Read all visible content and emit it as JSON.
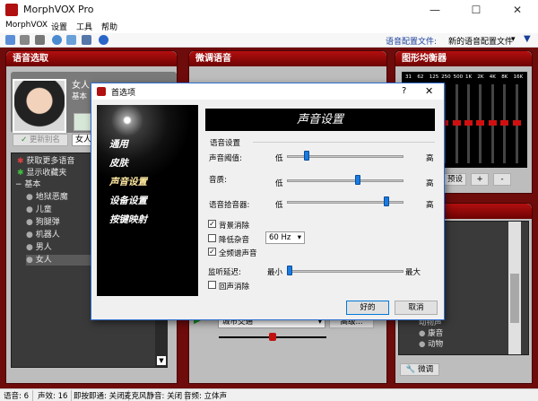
{
  "app": {
    "title": "MorphVOX Pro",
    "brand_color": "#b01010"
  },
  "window_controls": {
    "minimize": "—",
    "maximize": "☐",
    "close": "✕"
  },
  "menu": [
    "MorphVOX",
    "设置",
    "工具",
    "帮助"
  ],
  "toolbar": {
    "voice_config_label": "语音配置文件:",
    "voice_config_value": "新的语音配置文件",
    "filter_icon": "filter-icon"
  },
  "panels": {
    "voice_select": {
      "title": "语音选取"
    },
    "tweak_voice": {
      "title": "微调语音"
    },
    "equalizer": {
      "title": "图形均衡器",
      "bands": [
        "31",
        "62",
        "125",
        "250",
        "500",
        "1K",
        "2K",
        "4K",
        "8K",
        "16K"
      ],
      "preset_label": "预设",
      "plus": "+",
      "minus": "-"
    }
  },
  "voice_card": {
    "name": "女人",
    "category": "基本",
    "rename_label": "更新别名",
    "alias_value": "女人"
  },
  "voice_tree": [
    "获取更多语音",
    "显示收藏夹",
    "基本",
    "地狱恶魔",
    "儿童",
    "狗腿弹",
    "机器人",
    "男人",
    "女人"
  ],
  "background": {
    "play_icon": "play-icon",
    "value": "城市交通",
    "advanced_label": "高级..."
  },
  "sound_list": [
    "动物声",
    "康音",
    "动物"
  ],
  "tweak_button": "微调",
  "dialog": {
    "title": "首选项",
    "help": "?",
    "close": "✕",
    "nav": [
      "通用",
      "皮肤",
      "声音设置",
      "设备设置",
      "按键映射"
    ],
    "nav_selected": "声音设置",
    "header": "声音设置",
    "group_label": "语音设置",
    "sliders": [
      {
        "label": "声音阈值:",
        "low": "低",
        "high": "高",
        "value": 0.15
      },
      {
        "label": "音质:",
        "low": "低",
        "high": "高",
        "value": 0.61
      },
      {
        "label": "语音拾音器:",
        "low": "低",
        "high": "高",
        "value": 0.87
      }
    ],
    "checkboxes": [
      {
        "label": "背景消除",
        "checked": true
      },
      {
        "label": "降低杂音",
        "checked": false
      },
      {
        "label": "全频谱声音",
        "checked": true
      }
    ],
    "hum_select": "60 Hz",
    "latency": {
      "label": "监听延迟:",
      "min": "最小",
      "max": "最大",
      "value": 0.0
    },
    "echo_cancel": {
      "label": "回声消除",
      "checked": false
    },
    "ok": "好的",
    "cancel": "取消"
  },
  "status": [
    "语音: 6",
    "声效: 16",
    "即按即通: 关闭",
    "麦克风静音: 关闭",
    "音频: 立体声"
  ]
}
